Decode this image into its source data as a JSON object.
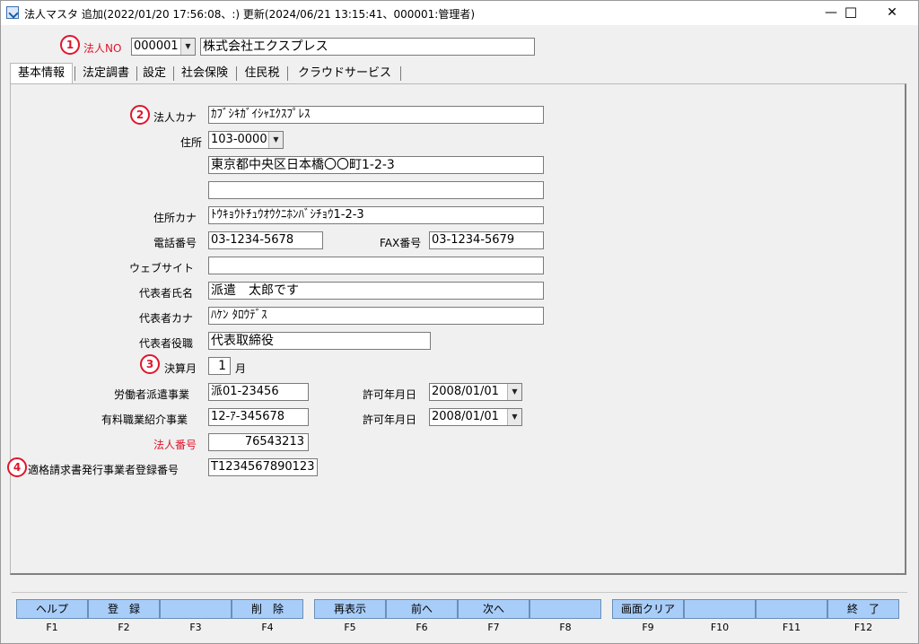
{
  "window": {
    "title": "法人マスタ 追加(2022/01/20 17:56:08、:) 更新(2024/06/21 13:15:41、000001:管理者)",
    "minimize_glyph": "—",
    "maximize_glyph": "☐",
    "close_glyph": "✕"
  },
  "header": {
    "marker": "1",
    "label": "法人NO",
    "corp_no": "000001",
    "corp_name": "株式会社エクスプレス"
  },
  "tabs": [
    "基本情報",
    "法定調書",
    "設定",
    "社会保険",
    "住民税",
    "クラウドサービス"
  ],
  "form": {
    "marker2": "2",
    "kana_label": "法人カナ",
    "kana_value": "ｶﾌﾞｼｷｶﾞｲｼｬｴｸｽﾌﾟﾚｽ",
    "address_label": "住所",
    "postal_code": "103-0000",
    "address1": "東京都中央区日本橋〇〇町1-2-3",
    "address2": "",
    "address_kana_label": "住所カナ",
    "address_kana_value": "ﾄｳｷｮｳﾄﾁｭｳｵｳｸﾆﾎﾝﾊﾞｼﾁｮｳ1-2-3",
    "phone_label": "電話番号",
    "phone_value": "03-1234-5678",
    "fax_label": "FAX番号",
    "fax_value": "03-1234-5679",
    "website_label": "ウェブサイト",
    "website_value": "",
    "rep_name_label": "代表者氏名",
    "rep_name_value": "派遣　太郎です",
    "rep_kana_label": "代表者カナ",
    "rep_kana_value": "ﾊｹﾝ ﾀﾛｳﾃﾞｽ",
    "rep_title_label": "代表者役職",
    "rep_title_value": "代表取締役",
    "marker3": "3",
    "fiscal_label": "決算月",
    "fiscal_value": "1",
    "fiscal_unit": "月",
    "dispatch_label": "労働者派遣事業",
    "dispatch_value": "派01-23456",
    "dispatch_date_label": "許可年月日",
    "dispatch_date_value": "2008/01/01",
    "placement_label": "有料職業紹介事業",
    "placement_value": "12-ｱ-345678",
    "placement_date_label": "許可年月日",
    "placement_date_value": "2008/01/01",
    "corp_number_label": "法人番号",
    "corp_number_value": "76543213",
    "marker4": "4",
    "invoice_label": "適格請求書発行事業者登録番号",
    "invoice_value": "T1234567890123"
  },
  "fkeys": [
    {
      "label": "ヘルプ",
      "key": "F1"
    },
    {
      "label": "登　録",
      "key": "F2"
    },
    {
      "label": "",
      "key": "F3"
    },
    {
      "label": "削　除",
      "key": "F4"
    },
    {
      "label": "再表示",
      "key": "F5"
    },
    {
      "label": "前へ",
      "key": "F6"
    },
    {
      "label": "次へ",
      "key": "F7"
    },
    {
      "label": "",
      "key": "F8"
    },
    {
      "label": "画面クリア",
      "key": "F9"
    },
    {
      "label": "",
      "key": "F10"
    },
    {
      "label": "",
      "key": "F11"
    },
    {
      "label": "終　了",
      "key": "F12"
    }
  ],
  "colors": {
    "accent_red": "#e0162b",
    "fkey_blue": "#a8cdf8"
  }
}
